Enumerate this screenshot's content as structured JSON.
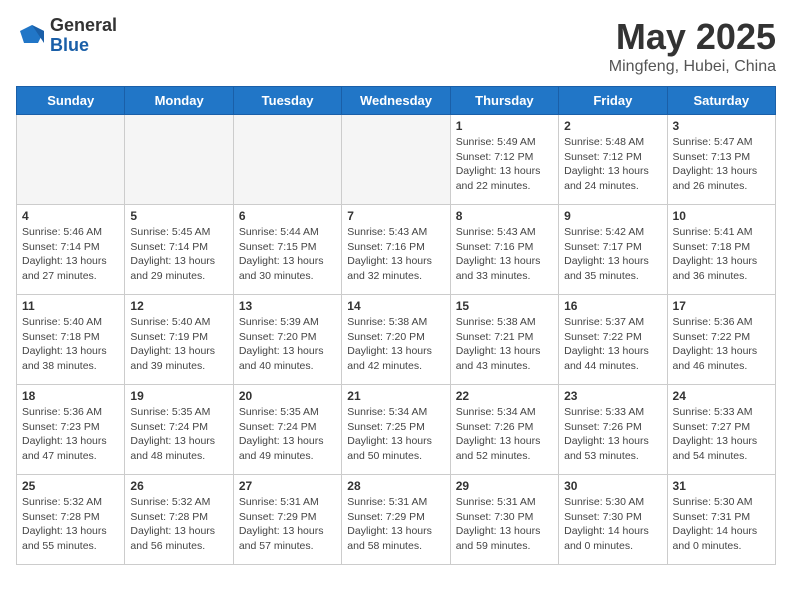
{
  "logo": {
    "general": "General",
    "blue": "Blue"
  },
  "title": "May 2025",
  "subtitle": "Mingfeng, Hubei, China",
  "headers": [
    "Sunday",
    "Monday",
    "Tuesday",
    "Wednesday",
    "Thursday",
    "Friday",
    "Saturday"
  ],
  "weeks": [
    [
      {
        "day": "",
        "info": ""
      },
      {
        "day": "",
        "info": ""
      },
      {
        "day": "",
        "info": ""
      },
      {
        "day": "",
        "info": ""
      },
      {
        "day": "1",
        "info": "Sunrise: 5:49 AM\nSunset: 7:12 PM\nDaylight: 13 hours and 22 minutes."
      },
      {
        "day": "2",
        "info": "Sunrise: 5:48 AM\nSunset: 7:12 PM\nDaylight: 13 hours and 24 minutes."
      },
      {
        "day": "3",
        "info": "Sunrise: 5:47 AM\nSunset: 7:13 PM\nDaylight: 13 hours and 26 minutes."
      }
    ],
    [
      {
        "day": "4",
        "info": "Sunrise: 5:46 AM\nSunset: 7:14 PM\nDaylight: 13 hours and 27 minutes."
      },
      {
        "day": "5",
        "info": "Sunrise: 5:45 AM\nSunset: 7:14 PM\nDaylight: 13 hours and 29 minutes."
      },
      {
        "day": "6",
        "info": "Sunrise: 5:44 AM\nSunset: 7:15 PM\nDaylight: 13 hours and 30 minutes."
      },
      {
        "day": "7",
        "info": "Sunrise: 5:43 AM\nSunset: 7:16 PM\nDaylight: 13 hours and 32 minutes."
      },
      {
        "day": "8",
        "info": "Sunrise: 5:43 AM\nSunset: 7:16 PM\nDaylight: 13 hours and 33 minutes."
      },
      {
        "day": "9",
        "info": "Sunrise: 5:42 AM\nSunset: 7:17 PM\nDaylight: 13 hours and 35 minutes."
      },
      {
        "day": "10",
        "info": "Sunrise: 5:41 AM\nSunset: 7:18 PM\nDaylight: 13 hours and 36 minutes."
      }
    ],
    [
      {
        "day": "11",
        "info": "Sunrise: 5:40 AM\nSunset: 7:18 PM\nDaylight: 13 hours and 38 minutes."
      },
      {
        "day": "12",
        "info": "Sunrise: 5:40 AM\nSunset: 7:19 PM\nDaylight: 13 hours and 39 minutes."
      },
      {
        "day": "13",
        "info": "Sunrise: 5:39 AM\nSunset: 7:20 PM\nDaylight: 13 hours and 40 minutes."
      },
      {
        "day": "14",
        "info": "Sunrise: 5:38 AM\nSunset: 7:20 PM\nDaylight: 13 hours and 42 minutes."
      },
      {
        "day": "15",
        "info": "Sunrise: 5:38 AM\nSunset: 7:21 PM\nDaylight: 13 hours and 43 minutes."
      },
      {
        "day": "16",
        "info": "Sunrise: 5:37 AM\nSunset: 7:22 PM\nDaylight: 13 hours and 44 minutes."
      },
      {
        "day": "17",
        "info": "Sunrise: 5:36 AM\nSunset: 7:22 PM\nDaylight: 13 hours and 46 minutes."
      }
    ],
    [
      {
        "day": "18",
        "info": "Sunrise: 5:36 AM\nSunset: 7:23 PM\nDaylight: 13 hours and 47 minutes."
      },
      {
        "day": "19",
        "info": "Sunrise: 5:35 AM\nSunset: 7:24 PM\nDaylight: 13 hours and 48 minutes."
      },
      {
        "day": "20",
        "info": "Sunrise: 5:35 AM\nSunset: 7:24 PM\nDaylight: 13 hours and 49 minutes."
      },
      {
        "day": "21",
        "info": "Sunrise: 5:34 AM\nSunset: 7:25 PM\nDaylight: 13 hours and 50 minutes."
      },
      {
        "day": "22",
        "info": "Sunrise: 5:34 AM\nSunset: 7:26 PM\nDaylight: 13 hours and 52 minutes."
      },
      {
        "day": "23",
        "info": "Sunrise: 5:33 AM\nSunset: 7:26 PM\nDaylight: 13 hours and 53 minutes."
      },
      {
        "day": "24",
        "info": "Sunrise: 5:33 AM\nSunset: 7:27 PM\nDaylight: 13 hours and 54 minutes."
      }
    ],
    [
      {
        "day": "25",
        "info": "Sunrise: 5:32 AM\nSunset: 7:28 PM\nDaylight: 13 hours and 55 minutes."
      },
      {
        "day": "26",
        "info": "Sunrise: 5:32 AM\nSunset: 7:28 PM\nDaylight: 13 hours and 56 minutes."
      },
      {
        "day": "27",
        "info": "Sunrise: 5:31 AM\nSunset: 7:29 PM\nDaylight: 13 hours and 57 minutes."
      },
      {
        "day": "28",
        "info": "Sunrise: 5:31 AM\nSunset: 7:29 PM\nDaylight: 13 hours and 58 minutes."
      },
      {
        "day": "29",
        "info": "Sunrise: 5:31 AM\nSunset: 7:30 PM\nDaylight: 13 hours and 59 minutes."
      },
      {
        "day": "30",
        "info": "Sunrise: 5:30 AM\nSunset: 7:30 PM\nDaylight: 14 hours and 0 minutes."
      },
      {
        "day": "31",
        "info": "Sunrise: 5:30 AM\nSunset: 7:31 PM\nDaylight: 14 hours and 0 minutes."
      }
    ]
  ]
}
